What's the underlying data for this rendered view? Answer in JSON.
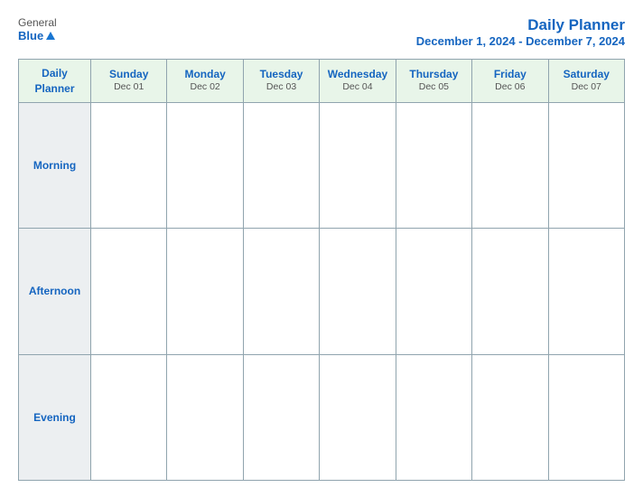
{
  "header": {
    "logo": {
      "general": "General",
      "blue": "Blue"
    },
    "title": "Daily Planner",
    "subtitle": "December 1, 2024 - December 7, 2024"
  },
  "table": {
    "first_col_label": "Daily Planner",
    "columns": [
      {
        "day": "Sunday",
        "date": "Dec 01"
      },
      {
        "day": "Monday",
        "date": "Dec 02"
      },
      {
        "day": "Tuesday",
        "date": "Dec 03"
      },
      {
        "day": "Wednesday",
        "date": "Dec 04"
      },
      {
        "day": "Thursday",
        "date": "Dec 05"
      },
      {
        "day": "Friday",
        "date": "Dec 06"
      },
      {
        "day": "Saturday",
        "date": "Dec 07"
      }
    ],
    "rows": [
      {
        "label": "Morning"
      },
      {
        "label": "Afternoon"
      },
      {
        "label": "Evening"
      }
    ]
  }
}
